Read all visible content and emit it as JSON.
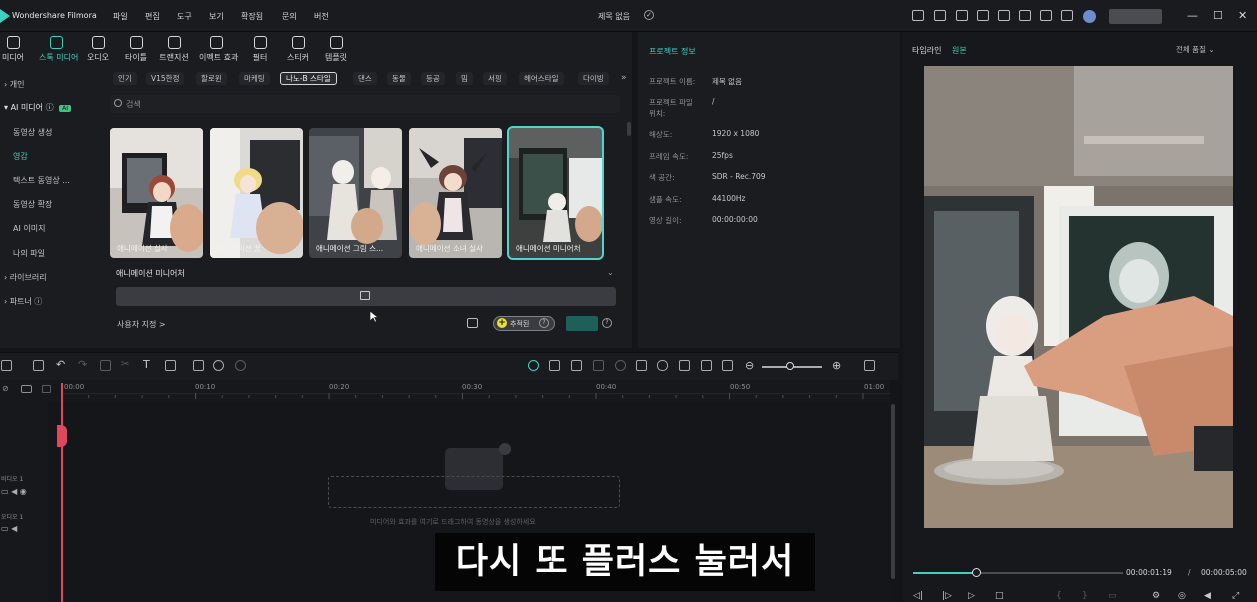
{
  "titlebar": {
    "app_name": "Wondershare Filmora",
    "menus": [
      "파일",
      "편집",
      "도구",
      "보기",
      "확장됨",
      "문의",
      "버전"
    ],
    "project_title": "제목 없음"
  },
  "toolbar": {
    "tools": [
      "미디어",
      "스톡 미디어",
      "오디오",
      "타이틀",
      "트랜지션",
      "이펙트 효과",
      "필터",
      "스티커",
      "템플릿"
    ]
  },
  "sidebar": {
    "items": [
      "개인",
      "AI 미디어",
      "동영상 생성",
      "영감",
      "텍스트 동영상 ...",
      "동영상 확장",
      "AI 이미지",
      "나의 파일",
      "라이브러리",
      "파트너"
    ],
    "ai_badge": "AI"
  },
  "content": {
    "chips": [
      "인기",
      "V15한정",
      "할로윈",
      "마케팅",
      "나노-B 스타일",
      "댄스",
      "동물",
      "등공",
      "밈",
      "서핑",
      "헤어스타일",
      "다이빙"
    ],
    "search_placeholder": "검색",
    "thumbnails": [
      "애니메이션 실사",
      "애니메이션 꿈",
      "애니메이션 그림 스...",
      "애니메이션 소녀 실사",
      "애니메이션 미니어처"
    ],
    "detail_title": "애니메이션 미니어처",
    "custom_link": "사용자 지정 >",
    "add_label": "추적된"
  },
  "info": {
    "title": "프로젝트 정보",
    "rows": [
      {
        "k": "프로젝트 이름:",
        "v": "제목 없음"
      },
      {
        "k": "프로젝트 파일",
        "v": "/"
      },
      {
        "k": "위치:",
        "v": ""
      },
      {
        "k": "해상도:",
        "v": "1920 x 1080"
      },
      {
        "k": "프레임 속도:",
        "v": "25fps"
      },
      {
        "k": "색 공간:",
        "v": "SDR - Rec.709"
      },
      {
        "k": "샘플 속도:",
        "v": "44100Hz"
      },
      {
        "k": "영상 길이:",
        "v": "00:00:00:00"
      }
    ]
  },
  "timeline": {
    "ticks": [
      "00:00",
      "00:10",
      "00:20",
      "00:30",
      "00:40",
      "00:50",
      "01:00"
    ],
    "track_labels": [
      "비디오 1",
      "오디오 1"
    ],
    "drop_hint": "미디어와 효과를 여기로 드래그하여 동영상을 생성하세요"
  },
  "preview": {
    "tab_timeline": "타임라인",
    "tab_original": "원본",
    "quality": "전체 품질",
    "current_time": "00:00:01:19",
    "separator": "/",
    "total_time": "00:00:05:00",
    "progress": 0.3
  },
  "subtitle": "다시 또 플러스 눌러서",
  "colors": {
    "accent": "#3ed1c2",
    "playhead": "#e0475a",
    "add_plus": "#e7e233"
  }
}
